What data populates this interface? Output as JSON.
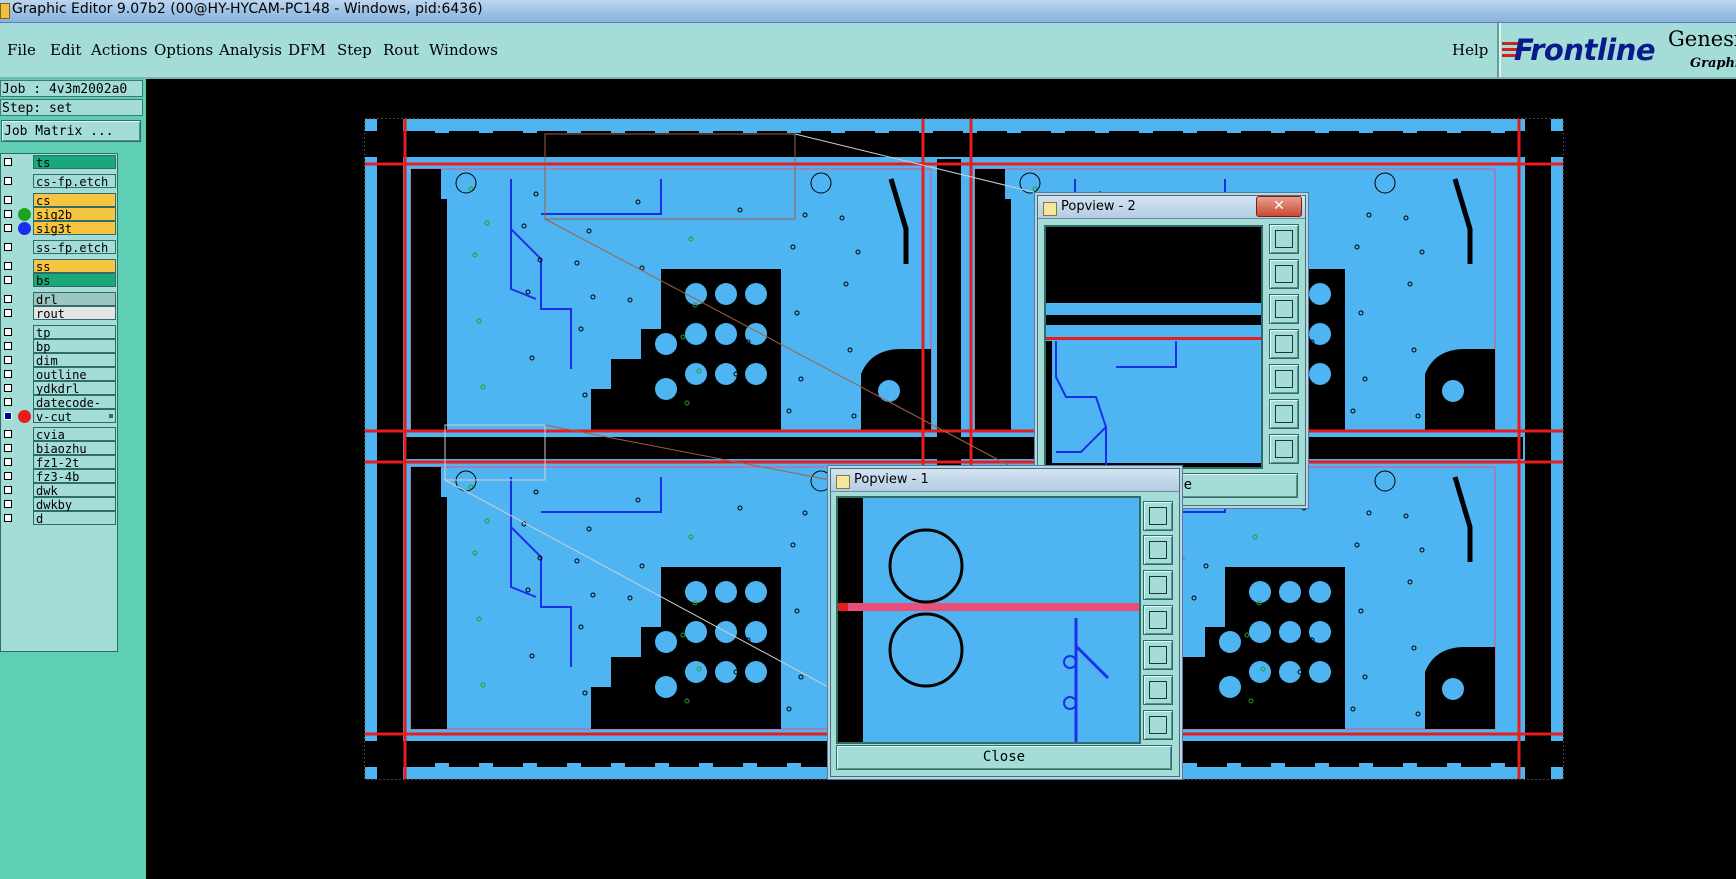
{
  "window": {
    "title": "Graphic Editor 9.07b2 (00@HY-HYCAM-PC148 - Windows, pid:6436)"
  },
  "menubar": {
    "items": [
      "File",
      "Edit",
      "Actions",
      "Options",
      "Analysis",
      "DFM",
      "Step",
      "Rout",
      "Windows"
    ],
    "help": "Help",
    "brand": {
      "logo": "Frontline",
      "product": "Genesis",
      "subtitle": "Graphic"
    }
  },
  "job": {
    "job_label": "Job : 4v3m2002a0",
    "step_label": "Step: set",
    "job_matrix_button": "Job Matrix ..."
  },
  "layers": [
    {
      "name": "ts",
      "color": "#1aa87a",
      "dot": null,
      "checked": false
    },
    {
      "name": "cs-fp.etch",
      "color": "#a4dcd8",
      "dot": null,
      "checked": false
    },
    {
      "name": "cs",
      "color": "#f5c542",
      "dot": null,
      "checked": false
    },
    {
      "name": "sig2b",
      "color": "#f5c542",
      "dot": "#1fa31f",
      "checked": false
    },
    {
      "name": "sig3t",
      "color": "#f5c542",
      "dot": "#1a30e8",
      "checked": false
    },
    {
      "name": "ss-fp.etch",
      "color": "#a4dcd8",
      "dot": null,
      "checked": false
    },
    {
      "name": "ss",
      "color": "#f5c542",
      "dot": null,
      "checked": false
    },
    {
      "name": "bs",
      "color": "#1aa87a",
      "dot": null,
      "checked": false
    },
    {
      "name": "drl",
      "color": "#9cc6c2",
      "dot": null,
      "checked": false
    },
    {
      "name": "rout",
      "color": "#e4e4e4",
      "dot": null,
      "checked": false
    },
    {
      "name": "tp",
      "color": "#a4dcd8",
      "dot": null,
      "checked": false
    },
    {
      "name": "bp",
      "color": "#a4dcd8",
      "dot": null,
      "checked": false
    },
    {
      "name": "dim",
      "color": "#a4dcd8",
      "dot": null,
      "checked": false
    },
    {
      "name": "outline",
      "color": "#a4dcd8",
      "dot": null,
      "checked": false
    },
    {
      "name": "ydkdrl",
      "color": "#a4dcd8",
      "dot": null,
      "checked": false
    },
    {
      "name": "datecode-ts",
      "color": "#a4dcd8",
      "dot": null,
      "checked": false
    },
    {
      "name": "v-cut",
      "color": "#a4dcd8",
      "dot": "#e81c1c",
      "checked": true,
      "active": true
    },
    {
      "name": "cvia",
      "color": "#a4dcd8",
      "dot": null,
      "checked": false
    },
    {
      "name": "biaozhu",
      "color": "#a4dcd8",
      "dot": null,
      "checked": false
    },
    {
      "name": "fz1-2t",
      "color": "#a4dcd8",
      "dot": null,
      "checked": false
    },
    {
      "name": "fz3-4b",
      "color": "#a4dcd8",
      "dot": null,
      "checked": false
    },
    {
      "name": "dwk",
      "color": "#a4dcd8",
      "dot": null,
      "checked": false
    },
    {
      "name": "dwkby",
      "color": "#a4dcd8",
      "dot": null,
      "checked": false
    },
    {
      "name": "d",
      "color": "#a4dcd8",
      "dot": null,
      "checked": false
    }
  ],
  "colors": {
    "board": "#4fb5f2",
    "copper": "#000000",
    "vcut": "#e81c1c",
    "trace": "#1a30e8",
    "via_green": "#1fa31f"
  },
  "popview2": {
    "title": "Popview - 2",
    "close_label": "Close",
    "close_x": "✕"
  },
  "popview1": {
    "title": "Popview - 1",
    "close_label": "Close"
  },
  "toolbar_icons": [
    "zoom-box-icon",
    "pan-up-icon",
    "pan-down-icon",
    "pan-left-icon",
    "pan-right-icon",
    "zoom-in-icon",
    "zoom-out-icon"
  ]
}
